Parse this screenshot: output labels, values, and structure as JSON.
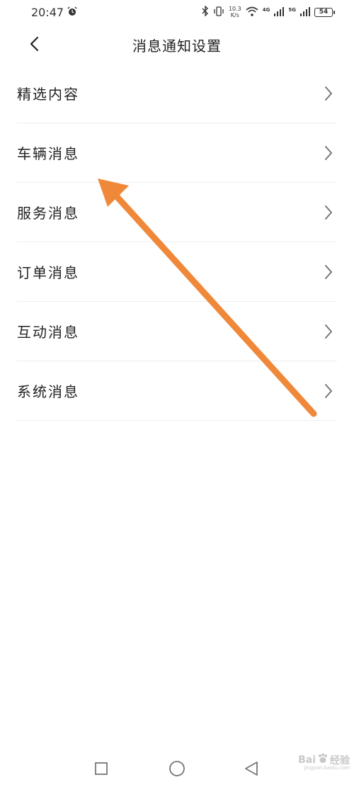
{
  "status_bar": {
    "time": "20:47",
    "net_speed_value": "10.3",
    "net_speed_unit": "K/s",
    "gen_1": "4G",
    "gen_2": "5G",
    "battery": "54",
    "icons": [
      "alarm-icon",
      "bluetooth-icon",
      "vibrate-icon",
      "wifi-icon",
      "signal-icon",
      "battery-icon"
    ]
  },
  "header": {
    "title": "消息通知设置",
    "back_icon": "chevron-left-icon"
  },
  "settings": {
    "items": [
      {
        "label": "精选内容"
      },
      {
        "label": "车辆消息"
      },
      {
        "label": "服务消息"
      },
      {
        "label": "订单消息"
      },
      {
        "label": "互动消息"
      },
      {
        "label": "系统消息"
      }
    ]
  },
  "annotation": {
    "color": "#f0883a"
  },
  "system_nav": {
    "buttons": [
      "recents-square-icon",
      "home-circle-icon",
      "back-triangle-icon"
    ]
  },
  "watermark": {
    "brand": "Bai",
    "brand_suffix": "经验",
    "url": "jingyan.baidu.com"
  },
  "colors": {
    "text": "#222222",
    "divider": "#eeeeee",
    "chevron": "#777777",
    "background": "#ffffff"
  }
}
